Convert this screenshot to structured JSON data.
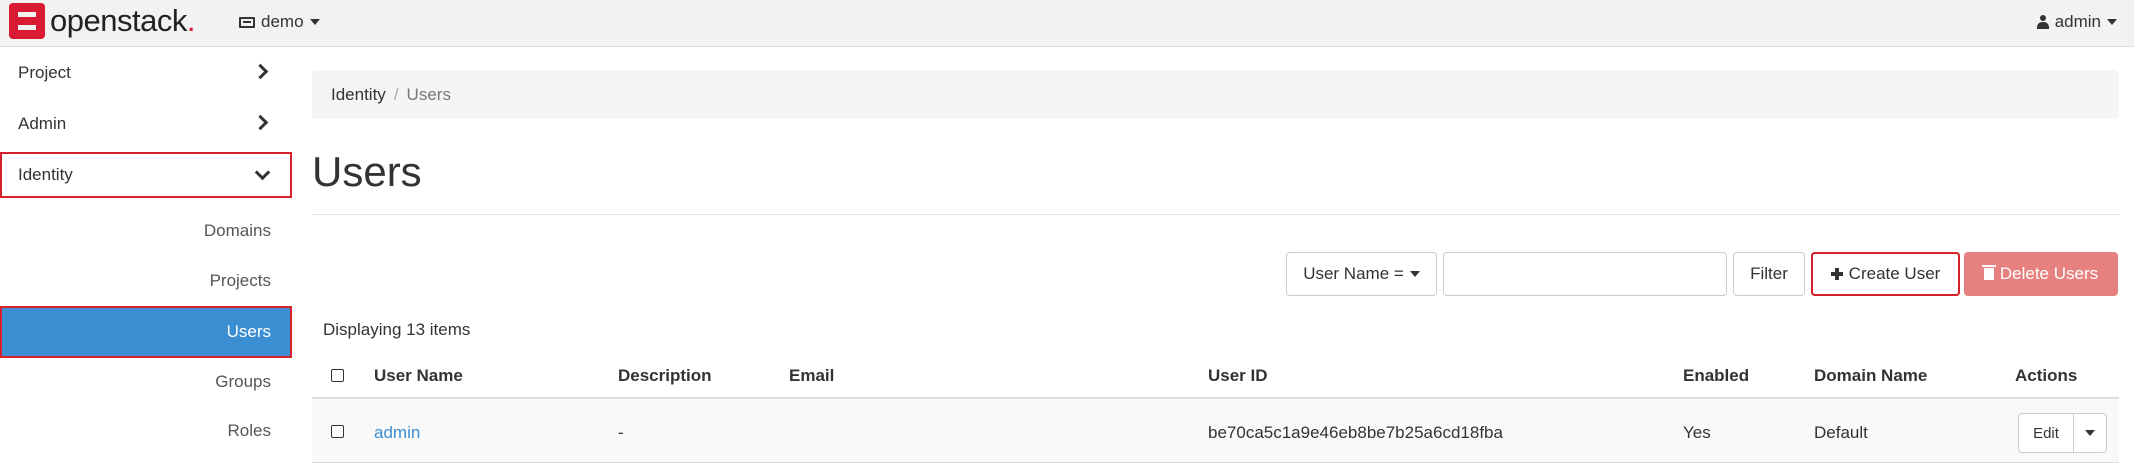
{
  "header": {
    "logo_text": "openstack",
    "logo_dot": ".",
    "project": "demo",
    "user": "admin"
  },
  "sidebar": {
    "items": [
      {
        "label": "Project"
      },
      {
        "label": "Admin"
      },
      {
        "label": "Identity"
      }
    ],
    "identity_sub": [
      {
        "label": "Domains"
      },
      {
        "label": "Projects"
      },
      {
        "label": "Users"
      },
      {
        "label": "Groups"
      },
      {
        "label": "Roles"
      }
    ]
  },
  "breadcrumb": {
    "parent": "Identity",
    "separator": "/",
    "current": "Users"
  },
  "page": {
    "title": "Users"
  },
  "toolbar": {
    "filter_select": "User Name =",
    "filter_value": "",
    "filter_button": "Filter",
    "create_button": "Create User",
    "delete_button": "Delete Users"
  },
  "table": {
    "count_text": "Displaying 13 items",
    "columns": [
      "User Name",
      "Description",
      "Email",
      "User ID",
      "Enabled",
      "Domain Name",
      "Actions"
    ],
    "rows": [
      {
        "user_name": "admin",
        "description": "-",
        "email": "",
        "user_id": "be70ca5c1a9e46eb8be7b25a6cd18fba",
        "enabled": "Yes",
        "domain": "Default",
        "action": "Edit"
      }
    ]
  },
  "colors": {
    "brand_red": "#da1a32",
    "active_blue": "#3c8ed2",
    "danger": "#e7817f",
    "highlight": "#d6212c"
  }
}
